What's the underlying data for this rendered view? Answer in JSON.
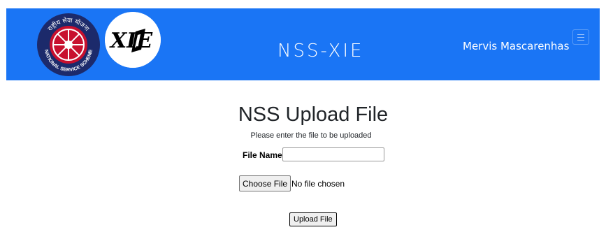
{
  "header": {
    "brand": "NSS-XIE",
    "user_name": "Mervis Mascarenhas",
    "nss_logo": {
      "top_text": "राष्ट्रीय सेवा योजना",
      "bottom_text": "NATIONAL SERVICE SCHEME"
    },
    "xie_logo": {
      "text": "XIE"
    },
    "colors": {
      "navbar": "#1a75f5",
      "nss_red": "#c8102e",
      "nss_navy": "#1c2a6b"
    }
  },
  "main": {
    "title": "NSS Upload File",
    "subtitle": "Please enter the file to be uploaded",
    "file_name_label": "File Name",
    "file_name_value": "",
    "choose_file_label": "Choose File",
    "file_status": "No file chosen",
    "upload_label": "Upload File"
  }
}
